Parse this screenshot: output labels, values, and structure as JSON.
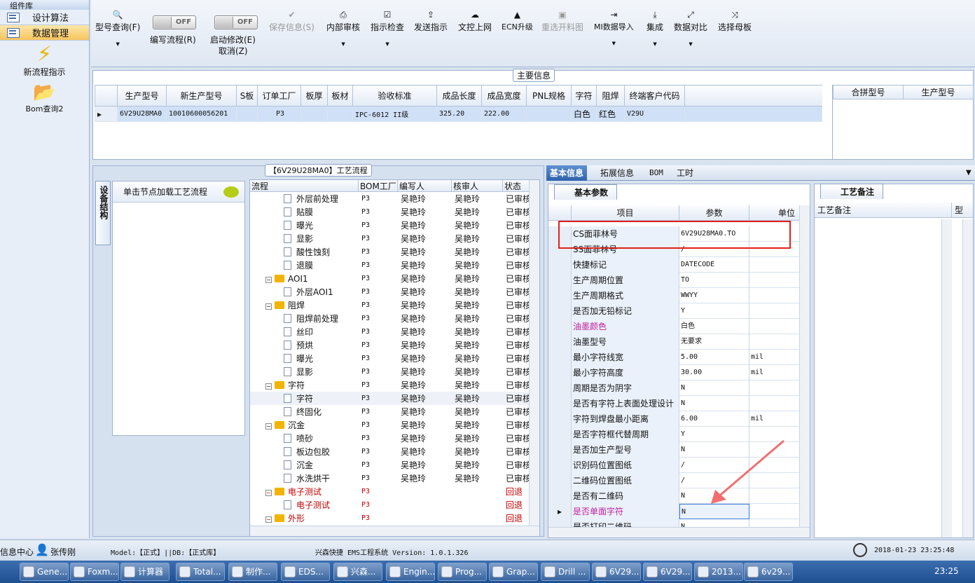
{
  "nav": {
    "header": "组件库",
    "items": [
      {
        "label": "设计算法"
      },
      {
        "label": "数据管理"
      }
    ],
    "new_flow": "新流程指示",
    "bom_query": "Bom查询2"
  },
  "toolbar": {
    "model_query": "型号查询(F)",
    "edit_flow": "编写流程(R)",
    "edit_toggle": "OFF",
    "start_modify": "启动修改(E)",
    "start_toggle": "OFF",
    "cancel": "取消(Z)",
    "save_info": "保存信息(S)",
    "internal_review": "内部审核",
    "instruction_check": "指示检查",
    "send_instruction": "发送指示",
    "upload_docs": "文控上网",
    "ecn_upgrade": "ECN升级",
    "reselect_material": "重选开料图",
    "mi_import": "MI数据导入",
    "integrate": "集成",
    "data_compare": "数据对比",
    "select_master": "选择母板"
  },
  "main_info": {
    "title": "主要信息",
    "columns": [
      "生产型号",
      "新生产型号",
      "S板",
      "订单工厂",
      "板厚",
      "板材",
      "验收标准",
      "成品长度",
      "成品宽度",
      "PNL规格",
      "字符",
      "阻焊",
      "终端客户代码"
    ],
    "row": [
      "6V29U28MA0",
      "10010600056201",
      "",
      "P3",
      "",
      "",
      "IPC-6012 II级",
      "325.20",
      "222.00",
      "",
      "白色",
      "红色",
      "V29U"
    ],
    "right_columns": [
      "合拼型号",
      "生产型号"
    ]
  },
  "workflow": {
    "title": "【6V29U28MA0】工艺流程",
    "side_tab": "设备结构",
    "node_hint": "单击节点加载工艺流程",
    "columns": [
      "流程",
      "BOM工厂",
      "编写人",
      "核审人",
      "状态"
    ],
    "rows": [
      {
        "name": "外层前处理",
        "level": 2,
        "type": "doc",
        "bom": "P3",
        "writer": "吴艳玲",
        "reviewer": "吴艳玲",
        "status": "已审核",
        "red": false
      },
      {
        "name": "贴膜",
        "level": 2,
        "type": "doc",
        "bom": "P3",
        "writer": "吴艳玲",
        "reviewer": "吴艳玲",
        "status": "已审核",
        "red": false
      },
      {
        "name": "曝光",
        "level": 2,
        "type": "doc",
        "bom": "P3",
        "writer": "吴艳玲",
        "reviewer": "吴艳玲",
        "status": "已审核",
        "red": false
      },
      {
        "name": "显影",
        "level": 2,
        "type": "doc",
        "bom": "P3",
        "writer": "吴艳玲",
        "reviewer": "吴艳玲",
        "status": "已审核",
        "red": false
      },
      {
        "name": "酸性蚀刻",
        "level": 2,
        "type": "doc",
        "bom": "P3",
        "writer": "吴艳玲",
        "reviewer": "吴艳玲",
        "status": "已审核",
        "red": false
      },
      {
        "name": "退膜",
        "level": 2,
        "type": "doc",
        "bom": "P3",
        "writer": "吴艳玲",
        "reviewer": "吴艳玲",
        "status": "已审核",
        "red": false
      },
      {
        "name": "AOI1",
        "level": 1,
        "type": "folder",
        "bom": "P3",
        "writer": "吴艳玲",
        "reviewer": "吴艳玲",
        "status": "已审核",
        "red": false
      },
      {
        "name": "外层AOI1",
        "level": 2,
        "type": "doc",
        "bom": "P3",
        "writer": "吴艳玲",
        "reviewer": "吴艳玲",
        "status": "已审核",
        "red": false
      },
      {
        "name": "阻焊",
        "level": 1,
        "type": "folder",
        "bom": "P3",
        "writer": "吴艳玲",
        "reviewer": "吴艳玲",
        "status": "已审核",
        "red": false
      },
      {
        "name": "阻焊前处理",
        "level": 2,
        "type": "doc",
        "bom": "P3",
        "writer": "吴艳玲",
        "reviewer": "吴艳玲",
        "status": "已审核",
        "red": false
      },
      {
        "name": "丝印",
        "level": 2,
        "type": "doc",
        "bom": "P3",
        "writer": "吴艳玲",
        "reviewer": "吴艳玲",
        "status": "已审核",
        "red": false
      },
      {
        "name": "预烘",
        "level": 2,
        "type": "doc",
        "bom": "P3",
        "writer": "吴艳玲",
        "reviewer": "吴艳玲",
        "status": "已审核",
        "red": false
      },
      {
        "name": "曝光",
        "level": 2,
        "type": "doc",
        "bom": "P3",
        "writer": "吴艳玲",
        "reviewer": "吴艳玲",
        "status": "已审核",
        "red": false
      },
      {
        "name": "显影",
        "level": 2,
        "type": "doc",
        "bom": "P3",
        "writer": "吴艳玲",
        "reviewer": "吴艳玲",
        "status": "已审核",
        "red": false
      },
      {
        "name": "字符",
        "level": 1,
        "type": "folder",
        "bom": "P3",
        "writer": "吴艳玲",
        "reviewer": "吴艳玲",
        "status": "已审核",
        "red": false
      },
      {
        "name": "字符",
        "level": 2,
        "type": "doc",
        "bom": "P3",
        "writer": "吴艳玲",
        "reviewer": "吴艳玲",
        "status": "已审核",
        "red": false,
        "hl": true
      },
      {
        "name": "终固化",
        "level": 2,
        "type": "doc",
        "bom": "P3",
        "writer": "吴艳玲",
        "reviewer": "吴艳玲",
        "status": "已审核",
        "red": false
      },
      {
        "name": "沉金",
        "level": 1,
        "type": "folder",
        "bom": "P3",
        "writer": "吴艳玲",
        "reviewer": "吴艳玲",
        "status": "已审核",
        "red": false
      },
      {
        "name": "喷砂",
        "level": 2,
        "type": "doc",
        "bom": "P3",
        "writer": "吴艳玲",
        "reviewer": "吴艳玲",
        "status": "已审核",
        "red": false
      },
      {
        "name": "板边包胶",
        "level": 2,
        "type": "doc",
        "bom": "P3",
        "writer": "吴艳玲",
        "reviewer": "吴艳玲",
        "status": "已审核",
        "red": false
      },
      {
        "name": "沉金",
        "level": 2,
        "type": "doc",
        "bom": "P3",
        "writer": "吴艳玲",
        "reviewer": "吴艳玲",
        "status": "已审核",
        "red": false
      },
      {
        "name": "水洗烘干",
        "level": 2,
        "type": "doc",
        "bom": "P3",
        "writer": "吴艳玲",
        "reviewer": "吴艳玲",
        "status": "已审核",
        "red": false
      },
      {
        "name": "电子测试",
        "level": 1,
        "type": "folder",
        "bom": "P3",
        "writer": "",
        "reviewer": "",
        "status": "回退",
        "red": true
      },
      {
        "name": "电子测试",
        "level": 2,
        "type": "doc",
        "bom": "P3",
        "writer": "",
        "reviewer": "",
        "status": "回退",
        "red": true
      },
      {
        "name": "外形",
        "level": 1,
        "type": "folder",
        "bom": "P3",
        "writer": "",
        "reviewer": "",
        "status": "回退",
        "red": true
      }
    ]
  },
  "right_tabs": [
    "基本信息",
    "拓展信息",
    "BOM",
    "工时"
  ],
  "params": {
    "tab": "基本参数",
    "columns": [
      "项目",
      "参数",
      "单位"
    ],
    "rows": [
      {
        "item": "CS面菲林号",
        "value": "6V29U28MA0.TO",
        "unit": ""
      },
      {
        "item": "SS面菲林号",
        "value": "/",
        "unit": ""
      },
      {
        "item": "快捷标记",
        "value": "DATECODE",
        "unit": ""
      },
      {
        "item": "生产周期位置",
        "value": "TO",
        "unit": ""
      },
      {
        "item": "生产周期格式",
        "value": "WWYY",
        "unit": ""
      },
      {
        "item": "是否加无铅标记",
        "value": "Y",
        "unit": ""
      },
      {
        "item": "油墨颜色",
        "value": "白色",
        "unit": "",
        "pink": true
      },
      {
        "item": "油墨型号",
        "value": "无要求",
        "unit": ""
      },
      {
        "item": "最小字符线宽",
        "value": "5.00",
        "unit": "mil"
      },
      {
        "item": "最小字符高度",
        "value": "30.00",
        "unit": "mil"
      },
      {
        "item": "周期是否为阴字",
        "value": "N",
        "unit": ""
      },
      {
        "item": "是否有字符上表面处理设计",
        "value": "N",
        "unit": ""
      },
      {
        "item": "字符到焊盘最小距离",
        "value": "6.00",
        "unit": "mil"
      },
      {
        "item": "是否字符框代替周期",
        "value": "Y",
        "unit": ""
      },
      {
        "item": "是否加生产型号",
        "value": "N",
        "unit": ""
      },
      {
        "item": "识别码位置图纸",
        "value": "/",
        "unit": ""
      },
      {
        "item": "二维码位置图纸",
        "value": "/",
        "unit": ""
      },
      {
        "item": "是否有二维码",
        "value": "N",
        "unit": ""
      },
      {
        "item": "是否单面字符",
        "value": "N",
        "unit": "",
        "pink": true,
        "current": true
      },
      {
        "item": "是否打印二维码",
        "value": "N",
        "unit": ""
      }
    ]
  },
  "notes": {
    "tab": "工艺备注",
    "col": "工艺备注",
    "col2": "型"
  },
  "status": {
    "msg_center": "信息中心",
    "user": "张传刚",
    "model": "Model:【正式】||DB:【正式库】",
    "system": "兴森快捷 EMS工程系统 Version: 1.0.1.326",
    "datetime": "2018-01-23 23:25:48"
  },
  "taskbar": {
    "tasks": [
      "Gene...",
      "Foxm...",
      "计算器",
      "Total...",
      "制作...",
      "EDS...",
      "兴森...",
      "Engin...",
      "Prog...",
      "Grap...",
      "Drill ...",
      "6V29...",
      "6V29...",
      "2013...",
      "6v29..."
    ],
    "clock": "23:25"
  }
}
